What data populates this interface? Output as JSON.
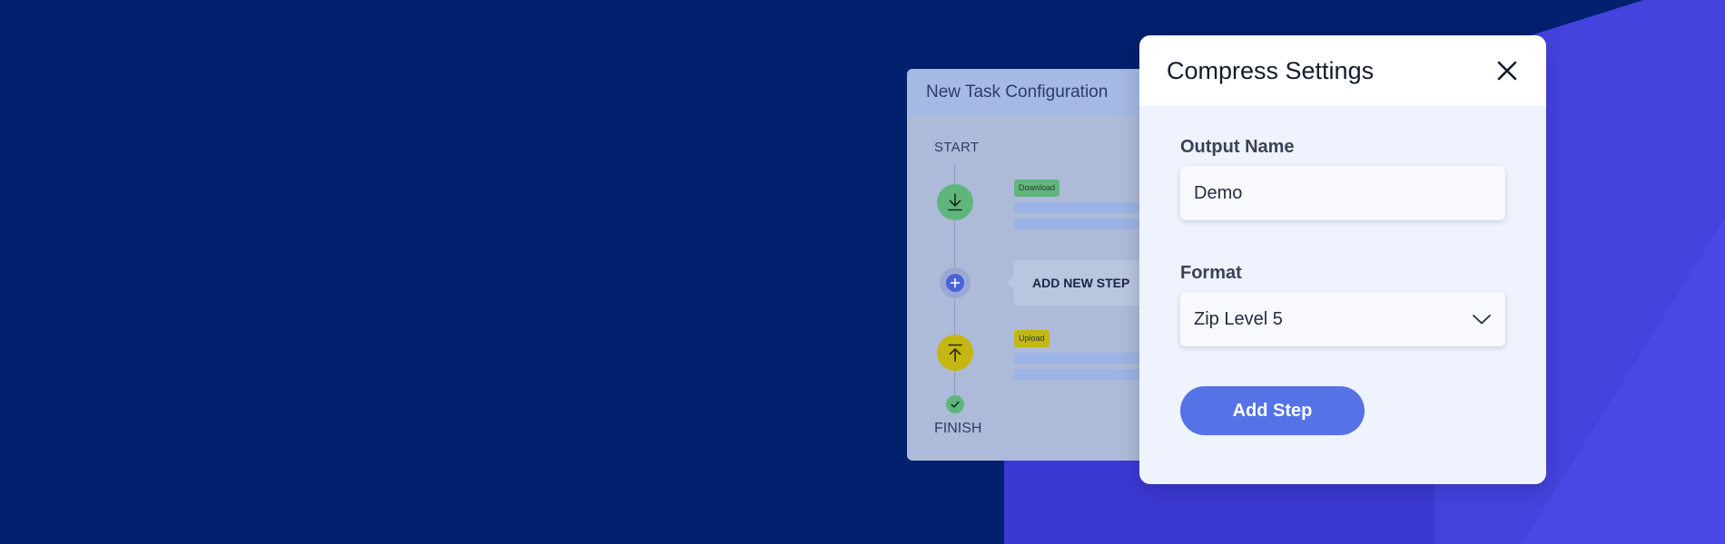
{
  "task_card": {
    "title": "New Task Configuration",
    "start_label": "START",
    "finish_label": "FINISH",
    "download_tag": "Download",
    "upload_tag": "Upload",
    "add_new_step_label": "ADD NEW STEP"
  },
  "modal": {
    "title": "Compress Settings",
    "output_name": {
      "label": "Output Name",
      "value": "Demo"
    },
    "format": {
      "label": "Format",
      "selected": "Zip Level 5"
    },
    "add_step_label": "Add Step"
  },
  "colors": {
    "background": "#01206d",
    "accent": "#5572e6",
    "download_node": "#5fb67c",
    "upload_node": "#c6b612"
  },
  "icons": {
    "close": "close-icon",
    "download": "download-arrow-icon",
    "add": "plus-icon",
    "upload": "upload-arrow-icon",
    "finish": "check-icon",
    "select": "chevron-down-icon"
  }
}
